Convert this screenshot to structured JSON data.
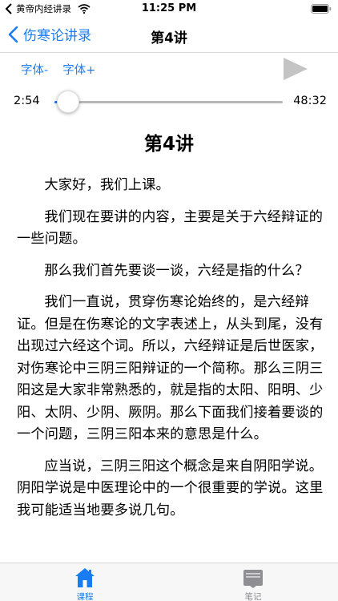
{
  "status_bar": {
    "carrier": "黄帝内经讲录",
    "time": "11:25 PM"
  },
  "nav": {
    "back_label": "伤寒论讲录",
    "title": "第4讲"
  },
  "font_controls": {
    "decrease_label": "字体-",
    "increase_label": "字体+"
  },
  "player": {
    "current_time": "2:54",
    "total_time": "48:32",
    "progress": 0.06
  },
  "article": {
    "title": "第4讲",
    "paragraphs": [
      "大家好，我们上课。",
      "我们现在要讲的内容，主要是关于六经辩证的一些问题。",
      "那么我们首先要谈一谈，六经是指的什么？",
      "我们一直说，贯穿伤寒论始终的，是六经辩证。但是在伤寒论的文字表述上，从头到尾，没有出现过六经这个词。所以，六经辩证是后世医家，对伤寒论中三阴三阳辩证的一个简称。那么三阴三阳这是大家非常熟悉的，就是指的太阳、阳明、少阳、太阴、少阴、厥阴。那么下面我们接着要谈的一个问题，三阴三阳本来的意思是什么。",
      "应当说，三阴三阳这个概念是来自阴阳学说。阴阳学说是中医理论中的一个很重要的学说。这里我可能适当地要多说几句。"
    ]
  },
  "tab_bar": {
    "course_label": "课程",
    "notes_label": "笔记"
  },
  "colors": {
    "accent": "#1a7cf2",
    "inactive": "#8e8e93"
  }
}
